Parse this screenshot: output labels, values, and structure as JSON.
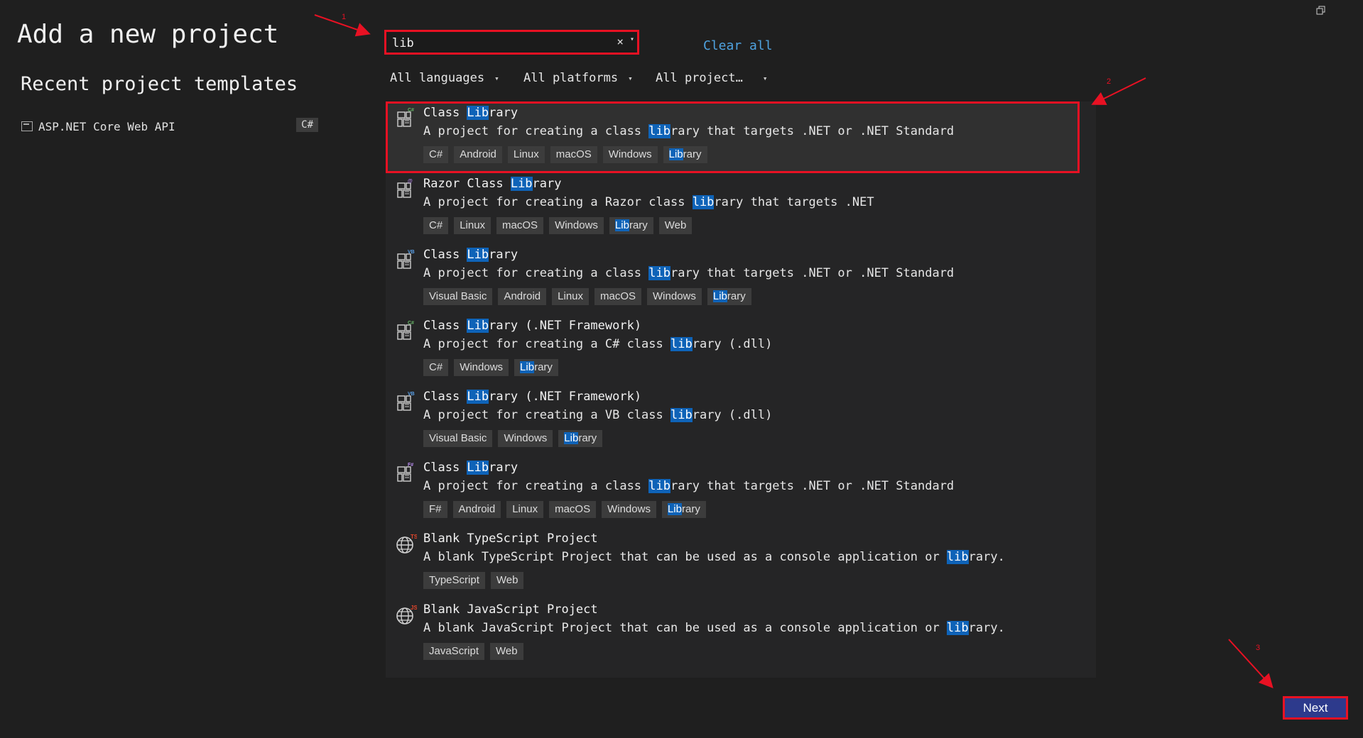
{
  "title": "Add a new project",
  "recent": {
    "heading": "Recent project templates",
    "items": [
      {
        "label": "ASP.NET Core Web API",
        "lang": "C#",
        "icon": "project-template-icon"
      }
    ]
  },
  "search": {
    "value": "lib",
    "clear_symbol": "×",
    "dropdown_symbol": "▾"
  },
  "clear_all": "Clear all",
  "filters": [
    {
      "label": "All languages"
    },
    {
      "label": "All platforms"
    },
    {
      "label": "All project…"
    }
  ],
  "filter_chevron": "▾",
  "templates": [
    {
      "icon": "csharp-class-library-icon",
      "badge": "C#",
      "title": [
        "Class ",
        "Lib",
        "rary"
      ],
      "desc": [
        "A project for creating a class ",
        "lib",
        "rary that targets .NET or .NET Standard"
      ],
      "tags": [
        "C#",
        "Android",
        "Linux",
        "macOS",
        "Windows",
        "Library"
      ]
    },
    {
      "icon": "razor-class-library-icon",
      "badge": "@",
      "title": [
        "Razor Class ",
        "Lib",
        "rary"
      ],
      "desc": [
        "A project for creating a Razor class ",
        "lib",
        "rary that targets .NET"
      ],
      "tags": [
        "C#",
        "Linux",
        "macOS",
        "Windows",
        "Library",
        "Web"
      ]
    },
    {
      "icon": "vb-class-library-icon",
      "badge": "VB",
      "title": [
        "Class ",
        "Lib",
        "rary"
      ],
      "desc": [
        "A project for creating a class ",
        "lib",
        "rary that targets .NET or .NET Standard"
      ],
      "tags": [
        "Visual Basic",
        "Android",
        "Linux",
        "macOS",
        "Windows",
        "Library"
      ]
    },
    {
      "icon": "csharp-framework-library-icon",
      "badge": "C#",
      "title": [
        "Class ",
        "Lib",
        "rary (.NET Framework)"
      ],
      "desc": [
        "A project for creating a C# class ",
        "lib",
        "rary (.dll)"
      ],
      "tags": [
        "C#",
        "Windows",
        "Library"
      ]
    },
    {
      "icon": "vb-framework-library-icon",
      "badge": "VB",
      "title": [
        "Class ",
        "Lib",
        "rary (.NET Framework)"
      ],
      "desc": [
        "A project for creating a VB class ",
        "lib",
        "rary (.dll)"
      ],
      "tags": [
        "Visual Basic",
        "Windows",
        "Library"
      ]
    },
    {
      "icon": "fsharp-class-library-icon",
      "badge": "F#",
      "title": [
        "Class ",
        "Lib",
        "rary"
      ],
      "desc": [
        "A project for creating a class ",
        "lib",
        "rary that targets .NET or .NET Standard"
      ],
      "tags": [
        "F#",
        "Android",
        "Linux",
        "macOS",
        "Windows",
        "Library"
      ]
    },
    {
      "icon": "typescript-globe-icon",
      "badge": "TS",
      "title": [
        "Blank TypeScript Project",
        "",
        ""
      ],
      "desc": [
        "A blank TypeScript Project that can be used as a console application or ",
        "lib",
        "rary."
      ],
      "tags": [
        "TypeScript",
        "Web"
      ]
    },
    {
      "icon": "javascript-globe-icon",
      "badge": "JS",
      "title": [
        "Blank JavaScript Project",
        "",
        ""
      ],
      "desc": [
        "A blank JavaScript Project that can be used as a console application or ",
        "lib",
        "rary."
      ],
      "tags": [
        "JavaScript",
        "Web"
      ]
    }
  ],
  "highlight_tag": "Library",
  "annotations": [
    "1",
    "2",
    "3"
  ],
  "next_label": "Next",
  "colors": {
    "background": "#1f1f1f",
    "panel": "#252526",
    "highlight": "#0e63b8",
    "annotation_red": "#e81123",
    "next_button": "#2d3a8c",
    "link": "#4fa3e0"
  }
}
